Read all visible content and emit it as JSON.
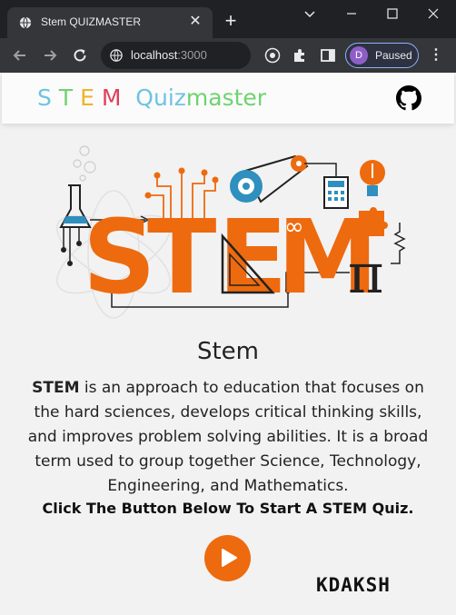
{
  "browser": {
    "tab_title": "Stem QUIZMASTER",
    "tab_close": "✕",
    "new_tab": "+",
    "url_host": "localhost",
    "url_port": ":3000",
    "profile_initial": "D",
    "profile_status": "Paused",
    "menu_glyph": "⋮"
  },
  "header": {
    "logo_stem": [
      "S",
      "T",
      "E",
      "M"
    ],
    "logo_quiz": "Quiz",
    "logo_master": "master"
  },
  "hero": {
    "letters": [
      "S",
      "T",
      "E",
      "M"
    ],
    "infinity": "∞",
    "pi": "π"
  },
  "content": {
    "title": "Stem",
    "description_bold": "STEM",
    "description_rest": " is an approach to education that focuses on the hard sciences, develops critical thinking skills, and improves problem solving abilities. It is a broad term used to group together Science, Technology, Engineering, and Mathematics.",
    "cta": "Click The Button Below To Start A STEM Quiz.",
    "watermark": "KDAKSH"
  },
  "colors": {
    "accent": "#ee6a0e",
    "chrome_dark": "#202124",
    "chrome_mid": "#35363a",
    "steel_blue": "#2f8fbf"
  }
}
